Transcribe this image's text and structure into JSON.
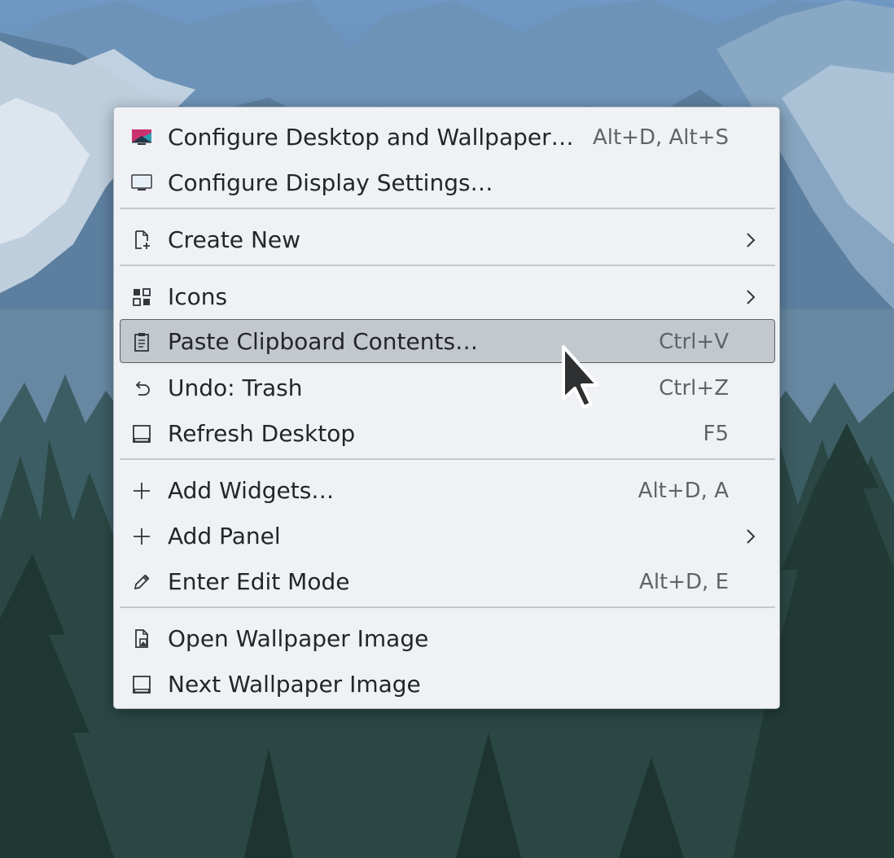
{
  "desktop": {
    "context_menu": {
      "groups": [
        [
          {
            "label": "Configure Desktop and Wallpaper…",
            "shortcut": "Alt+D, Alt+S",
            "icon": "desktop-settings-icon",
            "submenu": false
          },
          {
            "label": "Configure Display Settings…",
            "shortcut": "",
            "icon": "monitor-icon",
            "submenu": false
          }
        ],
        [
          {
            "label": "Create New",
            "shortcut": "",
            "icon": "new-document-icon",
            "submenu": true
          }
        ],
        [
          {
            "label": "Icons",
            "shortcut": "",
            "icon": "icons-grid-icon",
            "submenu": true
          },
          {
            "label": "Paste Clipboard Contents…",
            "shortcut": "Ctrl+V",
            "icon": "clipboard-icon",
            "submenu": false,
            "highlighted": true
          },
          {
            "label": "Undo: Trash",
            "shortcut": "Ctrl+Z",
            "icon": "undo-icon",
            "submenu": false
          },
          {
            "label": "Refresh Desktop",
            "shortcut": "F5",
            "icon": "desktop-frame-icon",
            "submenu": false
          }
        ],
        [
          {
            "label": "Add Widgets…",
            "shortcut": "Alt+D, A",
            "icon": "plus-icon",
            "submenu": false
          },
          {
            "label": "Add Panel",
            "shortcut": "",
            "icon": "plus-icon",
            "submenu": true
          },
          {
            "label": "Enter Edit Mode",
            "shortcut": "Alt+D, E",
            "icon": "pencil-icon",
            "submenu": false
          }
        ],
        [
          {
            "label": "Open Wallpaper Image",
            "shortcut": "",
            "icon": "image-file-icon",
            "submenu": false
          },
          {
            "label": "Next Wallpaper Image",
            "shortcut": "",
            "icon": "desktop-frame-icon",
            "submenu": false
          }
        ]
      ]
    },
    "colors": {
      "menu_background": "#eff1f5",
      "highlight_background": "#c2c8cd",
      "highlight_border": "#5b6167",
      "text": "#232629",
      "shortcut_text": "#5f6468"
    }
  }
}
